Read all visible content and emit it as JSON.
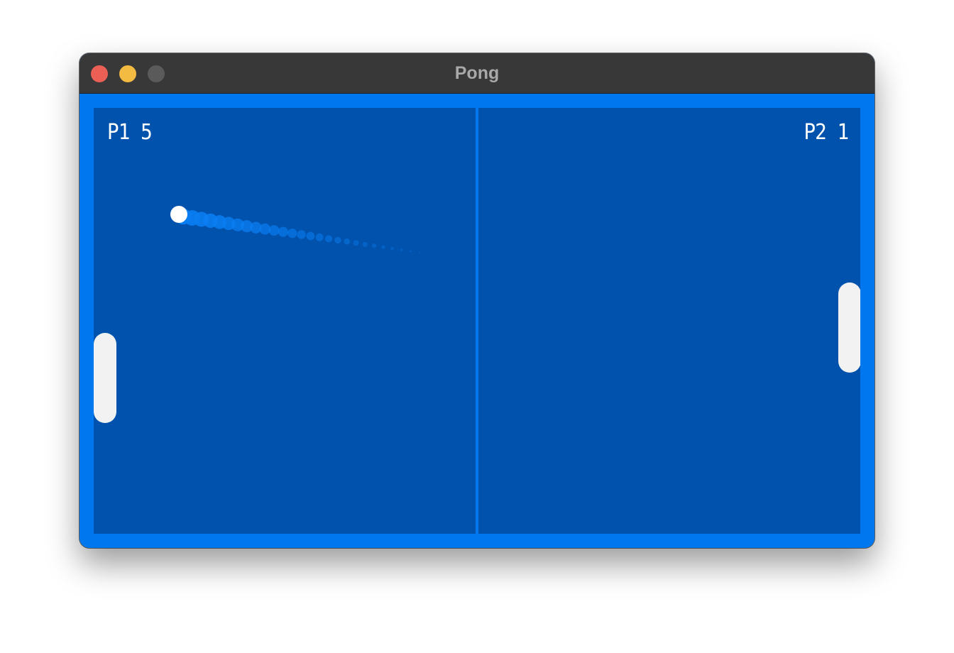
{
  "window": {
    "title": "Pong",
    "traffic_lights": [
      {
        "name": "close",
        "color": "#ec5f55"
      },
      {
        "name": "minimize",
        "color": "#f4bb43"
      },
      {
        "name": "zoom",
        "color": "#5a5a5a"
      }
    ]
  },
  "game": {
    "colors": {
      "frame": "#0077ee",
      "court": "#0052ad",
      "paddle": "#f2f2f2",
      "ball": "#ffffff",
      "trail": "#0a7ef2"
    },
    "scores": {
      "left_label": "P1 5",
      "right_label": "P2 1"
    }
  }
}
